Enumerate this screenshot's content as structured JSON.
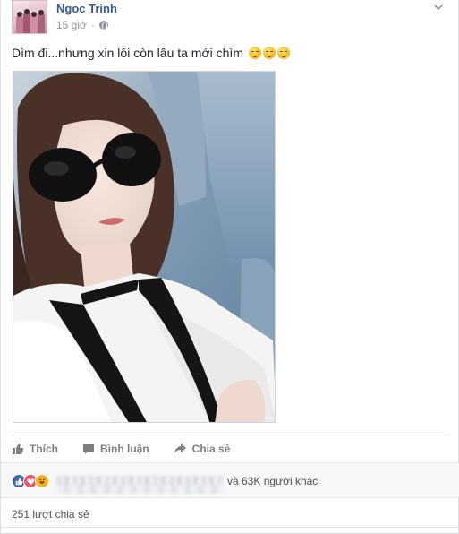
{
  "post": {
    "author": "Ngoc Trinh",
    "time": "15 giờ",
    "separator": "·",
    "text": "Dìm đi...nhưng xin lỗi còn lâu ta mới chìm",
    "text_emojis": [
      "relieved-face-emoji",
      "relieved-face-emoji",
      "relieved-face-emoji"
    ],
    "photo_icon": "selfie-photo",
    "privacy_icon": "globe-icon"
  },
  "actions": {
    "like": "Thích",
    "comment": "Bình luận",
    "share": "Chia sẻ"
  },
  "reactions": {
    "icons": [
      "like-reaction-icon",
      "love-reaction-icon",
      "haha-reaction-icon"
    ],
    "others": "và 63K người khác"
  },
  "shares": {
    "label": "251 lượt chia sẻ"
  },
  "colors": {
    "author_link": "#365899",
    "meta_gray": "#90949c",
    "like_blue": "#4267b2",
    "love_red": "#f25268",
    "haha_yellow": "#f7b125"
  }
}
